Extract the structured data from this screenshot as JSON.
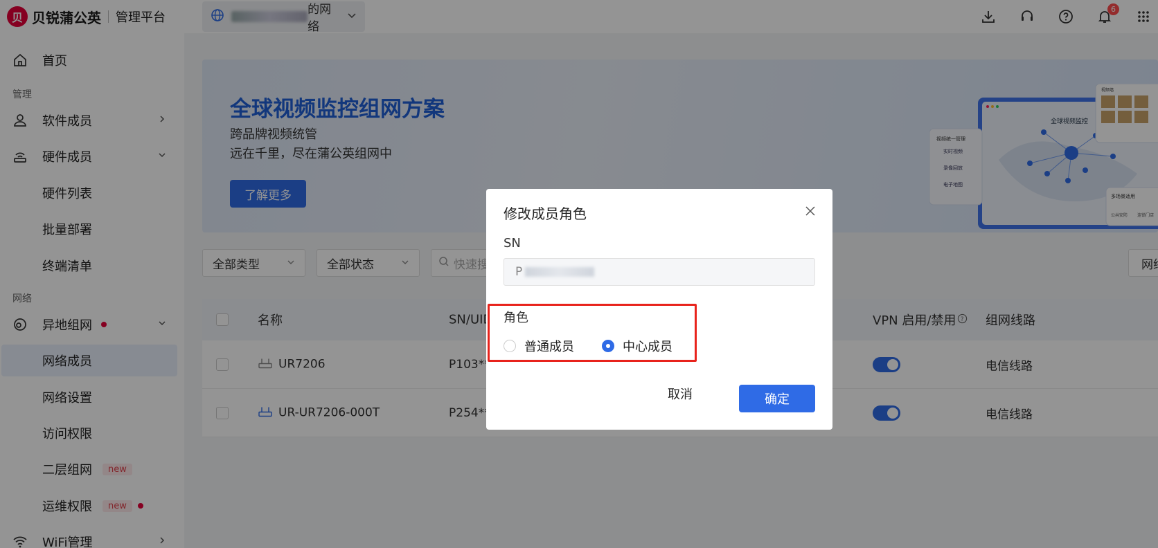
{
  "header": {
    "brand_logo": "贝",
    "brand_name": "贝锐蒲公英",
    "brand_sub": "管理平台",
    "network_suffix": "的网络",
    "notification_count": "6"
  },
  "sidebar": {
    "home": "首页",
    "section_manage": "管理",
    "software_members": "软件成员",
    "hardware_members": "硬件成员",
    "hardware_list": "硬件列表",
    "batch_deploy": "批量部署",
    "terminal_list": "终端清单",
    "section_network": "网络",
    "remote_networking": "异地组网",
    "network_members": "网络成员",
    "network_settings": "网络设置",
    "access_permissions": "访问权限",
    "layer2_networking": "二层组网",
    "ops_permissions": "运维权限",
    "wifi_management": "WiFi管理",
    "new_tag": "new"
  },
  "banner": {
    "title": "全球视频监控组网方案",
    "line1": "跨品牌视频统管",
    "line2": "远在千里，尽在蒲公英组网中",
    "button": "了解更多",
    "art_title": "全球视频监控",
    "art_panel": "视频统一管理",
    "art_item1": "实时视频",
    "art_item2": "录像回放",
    "art_item3": "电子地图",
    "art_scene": "多场景适用",
    "art_scene1": "公共安防",
    "art_scene2": "连锁门店",
    "art_thumb": "视频墙"
  },
  "filters": {
    "type": "全部类型",
    "status": "全部状态",
    "search_placeholder": "快速搜",
    "right_button": "网络"
  },
  "table": {
    "columns": {
      "name": "名称",
      "sn": "SN/UID",
      "vpn": "VPN 启用/禁用",
      "line": "组网线路"
    },
    "rows": [
      {
        "name": "UR7206",
        "sn": "P103**",
        "line": "电信线路"
      },
      {
        "name": "UR-UR7206-000T",
        "sn": "P254**",
        "line": "电信线路"
      }
    ]
  },
  "modal": {
    "title": "修改成员角色",
    "sn_label": "SN",
    "sn_value": "P",
    "role_label": "角色",
    "option_normal": "普通成员",
    "option_center": "中心成员",
    "selected": "中心成员",
    "cancel": "取消",
    "confirm": "确定"
  },
  "colors": {
    "primary": "#2f6be6",
    "brand": "#e60039",
    "highlight": "#e8231c"
  }
}
